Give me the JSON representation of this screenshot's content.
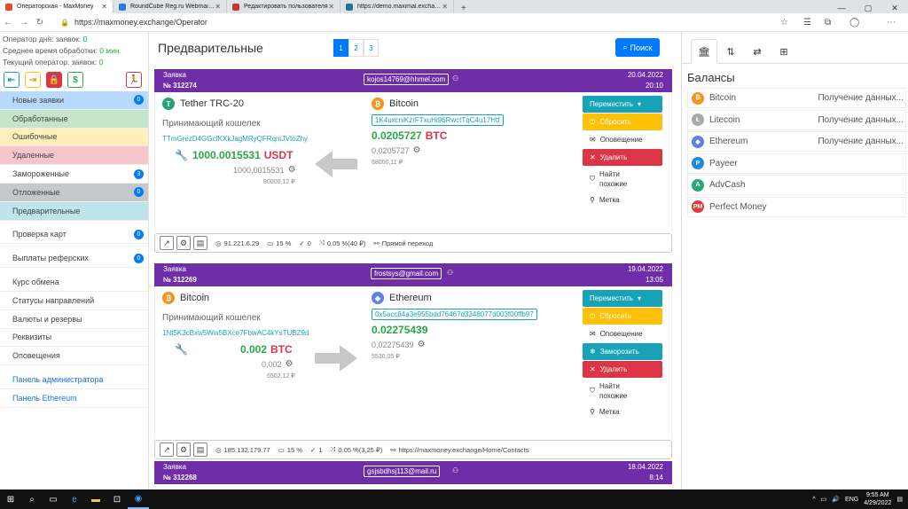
{
  "browser": {
    "tabs": [
      {
        "label": "Операторская - MaxMoney",
        "active": true,
        "color": "#e34a2f"
      },
      {
        "label": "RoundCube Reg.ru Webmail :: В",
        "active": false,
        "color": "#2d7bd6"
      },
      {
        "label": "Редактировать пользователя",
        "active": false,
        "color": "#c33"
      },
      {
        "label": "https://demo.maximal.exchange",
        "active": false,
        "color": "#21759b"
      }
    ],
    "url": "https://maxmoney.exchange/Operator"
  },
  "sidebar": {
    "stats": {
      "day_label": "Оператор дня:",
      "orders_label": "заявок:",
      "orders_value": "0",
      "avg_label": "Среднее время обработки:",
      "avg_value": "0 мин.",
      "current_label": "Текущий оператор:",
      "current_orders_label": "заявок:",
      "current_orders_value": "0"
    },
    "groups": [
      [
        {
          "label": "Новые заявки",
          "count": "0",
          "bg": "#b8daff"
        },
        {
          "label": "Обработанные",
          "bg": "#c3e6cb"
        },
        {
          "label": "Ошибочные",
          "bg": "#ffeeba"
        },
        {
          "label": "Удаленные",
          "bg": "#f5c6cb"
        },
        {
          "label": "Замороженные",
          "count": "3",
          "bg": "#ffffff"
        },
        {
          "label": "Отложенные",
          "count": "0",
          "bg": "#c6c8ca"
        },
        {
          "label": "Предварительные",
          "bg": "#bee5eb"
        }
      ],
      [
        {
          "label": "Проверка карт",
          "count": "0",
          "bg": "#ffffff"
        }
      ],
      [
        {
          "label": "Выплаты реферских",
          "count": "0",
          "bg": "#ffffff"
        }
      ],
      [
        {
          "label": "Курс обмена",
          "bg": "#ffffff"
        },
        {
          "label": "Статусы направлений",
          "bg": "#ffffff"
        },
        {
          "label": "Валюты и резервы",
          "bg": "#ffffff"
        },
        {
          "label": "Реквизиты",
          "bg": "#ffffff"
        },
        {
          "label": "Оповещения",
          "bg": "#ffffff"
        }
      ],
      [
        {
          "label": "Панель администратора",
          "bg": "#ffffff",
          "link": true
        },
        {
          "label": "Панель Ethereum",
          "bg": "#ffffff",
          "link": true
        }
      ]
    ]
  },
  "main": {
    "title": "Предварительные",
    "pages": [
      "1",
      "2",
      "3"
    ],
    "active_page": "1",
    "search_label": "Поиск",
    "orders": [
      {
        "label": "Заявка",
        "number": "№ 312274",
        "email": "kojos14769@hhmel.com",
        "date": "20.04.2022",
        "time": "20:10",
        "from": {
          "name": "Tether TRC-20",
          "icon": "T",
          "color": "#26a17b"
        },
        "wallet_label": "Принимающий кошелек",
        "from_wallet": "TTmGrezD4GGcfKXkJagMRyQFRqmJVtoZhy",
        "from_amount": "1000.0015531",
        "from_currency": "USDT",
        "from_small": "1000,0015531",
        "from_rub": "80000,12 ₽",
        "to": {
          "name": "Bitcoin",
          "icon": "₿",
          "color": "#f7931a"
        },
        "to_wallet": "1K4uxcniKzrFTxuHi96RwctTqC4u17Htf",
        "to_amount": "0.0205727",
        "to_currency": "BTC",
        "to_small": "0,0205727",
        "to_rub": "68000,11 ₽",
        "actions": [
          "Переместить",
          "Сбросить",
          "Оповещение",
          "Удалить",
          "Найти похожие",
          "Метка"
        ],
        "footer": {
          "ip": "91.221.6.29",
          "pct": "15 %",
          "checks": "0",
          "fee": "0.05 %(40 ₽)",
          "link": "Прямой переход"
        }
      },
      {
        "label": "Заявка",
        "number": "№ 312269",
        "email": "frostsys@gmail.com",
        "date": "19.04.2022",
        "time": "13:05",
        "from": {
          "name": "Bitcoin",
          "icon": "₿",
          "color": "#f7931a"
        },
        "wallet_label": "Принимающий кошелек",
        "from_wallet": "1Nt5K3cBxw5Ww5BXce7FbwAC4kYsTUBZ9d",
        "from_amount": "0.002",
        "from_currency": "BTC",
        "from_small": "0,002",
        "from_rub": "6502,12 ₽",
        "to": {
          "name": "Ethereum",
          "icon": "◆",
          "color": "#627eea"
        },
        "to_wallet": "0x5acc84a3e955bdd76467d3348077d003f00ffb97",
        "to_amount": "0.02275439",
        "to_currency": "",
        "to_small": "0,02275439",
        "to_rub": "5530,05 ₽",
        "actions": [
          "Переместить",
          "Сбросить",
          "Оповещение",
          "Заморозить",
          "Удалить",
          "Найти похожие",
          "Метка"
        ],
        "footer": {
          "ip": "185.132.179.77",
          "pct": "15 %",
          "checks": "1",
          "fee": "0.05 %(3,25 ₽)",
          "link": "https://maxmoney.exchange/Home/Contacts"
        }
      },
      {
        "label": "Заявка",
        "number": "№ 312268",
        "email": "gsjsbdhsj113@mail.ru",
        "date": "18.04.2022",
        "time": "8:14"
      }
    ]
  },
  "balances": {
    "title": "Балансы",
    "items": [
      {
        "name": "Bitcoin",
        "value": "Получение данных...",
        "icon": "₿",
        "color": "#f7931a"
      },
      {
        "name": "Litecoin",
        "value": "Получение данных...",
        "icon": "Ł",
        "color": "#a6a9aa"
      },
      {
        "name": "Ethereum",
        "value": "Получение данных...",
        "icon": "◆",
        "color": "#627eea"
      },
      {
        "name": "Payeer",
        "value": "",
        "icon": "P",
        "color": "#1e88e5"
      },
      {
        "name": "AdvCash",
        "value": "",
        "icon": "A",
        "color": "#2aa876"
      },
      {
        "name": "Perfect Money",
        "value": "",
        "icon": "PM",
        "color": "#e53935"
      }
    ]
  },
  "taskbar": {
    "lang": "ENG",
    "time": "9:55 AM",
    "date": "4/29/2022"
  }
}
